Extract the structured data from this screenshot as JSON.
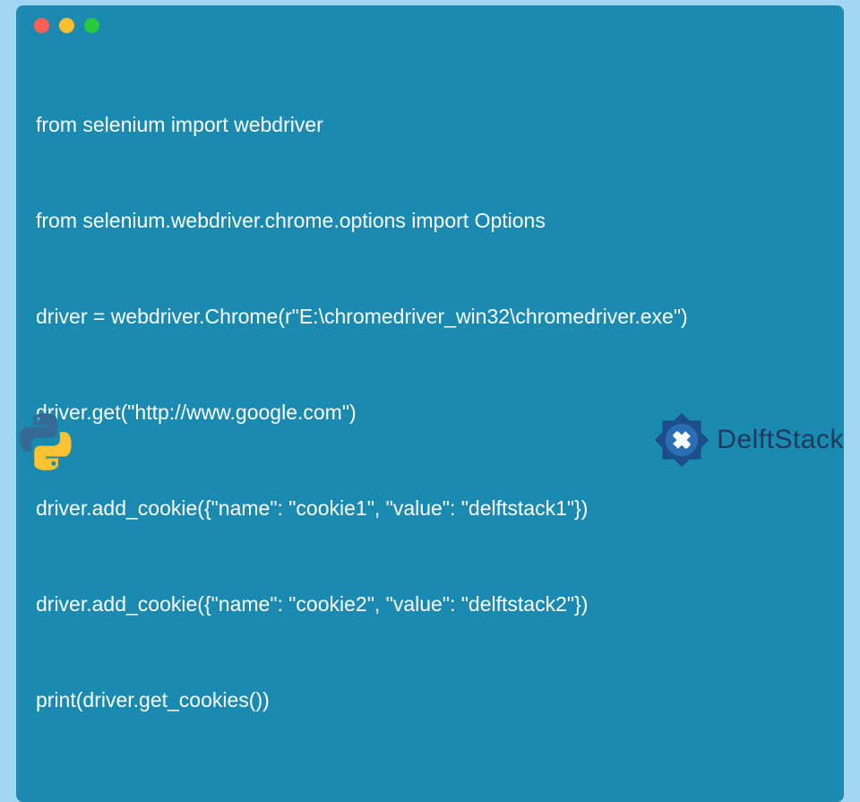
{
  "code": {
    "lines": [
      "from selenium import webdriver",
      "from selenium.webdriver.chrome.options import Options",
      "driver = webdriver.Chrome(r\"E:\\chromedriver_win32\\chromedriver.exe\")",
      "driver.get(\"http://www.google.com\")",
      "driver.add_cookie({\"name\": \"cookie1\", \"value\": \"delftstack1\"})",
      "driver.add_cookie({\"name\": \"cookie2\", \"value\": \"delftstack2\"})",
      "print(driver.get_cookies())"
    ]
  },
  "brand": {
    "name": "DelftStack"
  },
  "language": "Python"
}
